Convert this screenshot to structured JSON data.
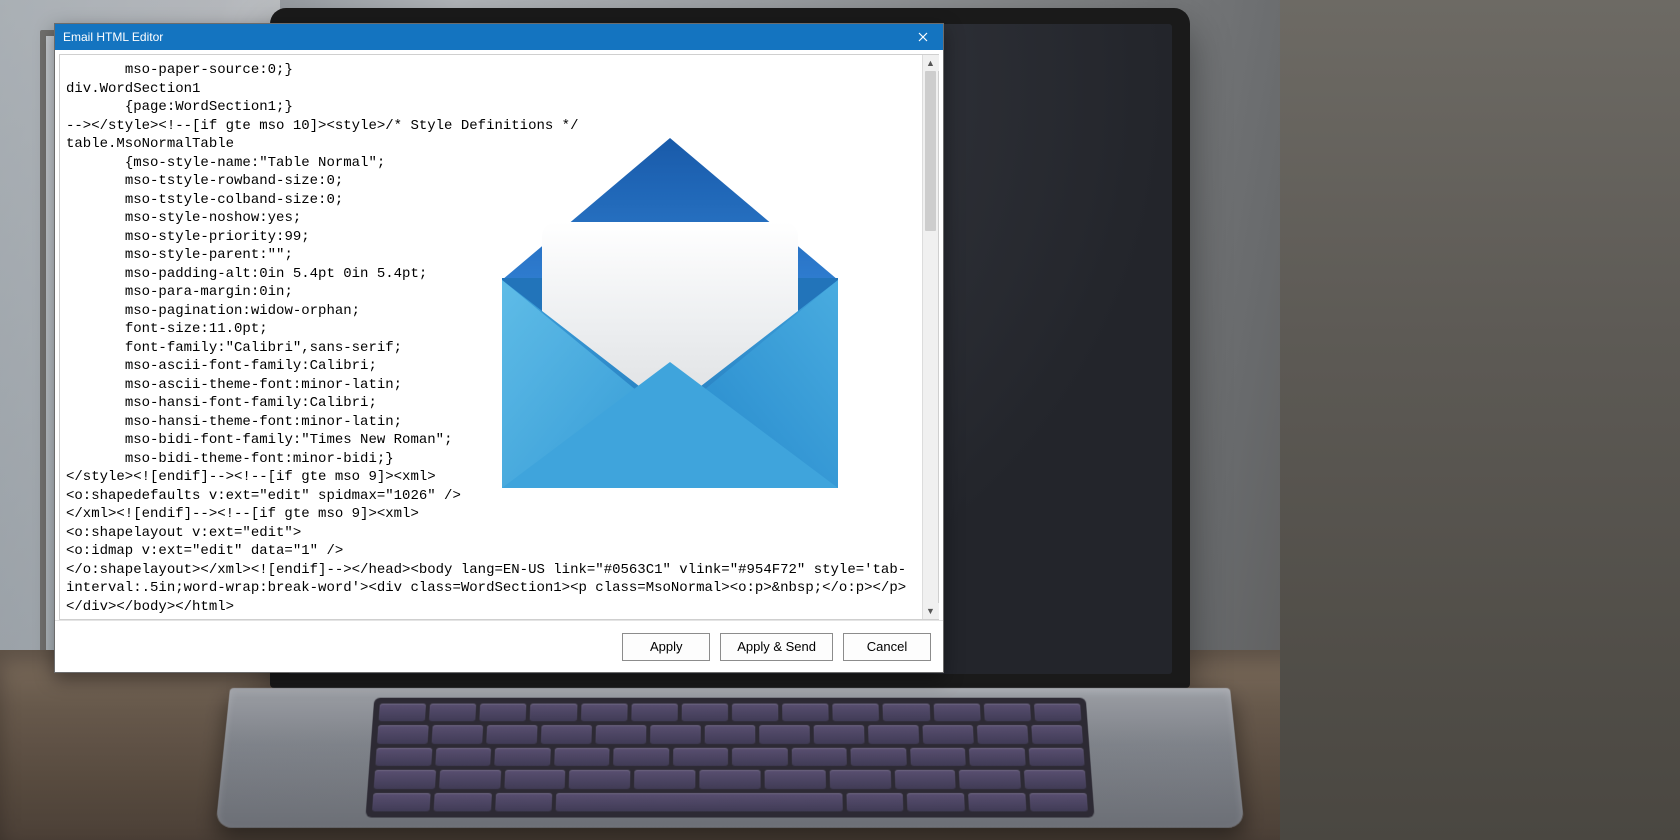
{
  "window": {
    "title": "Email HTML Editor"
  },
  "editor": {
    "content": "       mso-paper-source:0;}\ndiv.WordSection1\n       {page:WordSection1;}\n--></style><!--[if gte mso 10]><style>/* Style Definitions */\ntable.MsoNormalTable\n       {mso-style-name:\"Table Normal\";\n       mso-tstyle-rowband-size:0;\n       mso-tstyle-colband-size:0;\n       mso-style-noshow:yes;\n       mso-style-priority:99;\n       mso-style-parent:\"\";\n       mso-padding-alt:0in 5.4pt 0in 5.4pt;\n       mso-para-margin:0in;\n       mso-pagination:widow-orphan;\n       font-size:11.0pt;\n       font-family:\"Calibri\",sans-serif;\n       mso-ascii-font-family:Calibri;\n       mso-ascii-theme-font:minor-latin;\n       mso-hansi-font-family:Calibri;\n       mso-hansi-theme-font:minor-latin;\n       mso-bidi-font-family:\"Times New Roman\";\n       mso-bidi-theme-font:minor-bidi;}\n</style><![endif]--><!--[if gte mso 9]><xml>\n<o:shapedefaults v:ext=\"edit\" spidmax=\"1026\" />\n</xml><![endif]--><!--[if gte mso 9]><xml>\n<o:shapelayout v:ext=\"edit\">\n<o:idmap v:ext=\"edit\" data=\"1\" />\n</o:shapelayout></xml><![endif]--></head><body lang=EN-US link=\"#0563C1\" vlink=\"#954F72\" style='tab-interval:.5in;word-wrap:break-word'><div class=WordSection1><p class=MsoNormal><o:p>&nbsp;</o:p></p></div></body></html>"
  },
  "buttons": {
    "apply": "Apply",
    "apply_send": "Apply & Send",
    "cancel": "Cancel"
  },
  "icon": {
    "name": "mail-envelope-icon",
    "colors": {
      "back_top": "#0a5cbf",
      "back_bot": "#1d7fe6",
      "front_light": "#37b4f3",
      "front_dark": "#0f8ae0",
      "paper": "#f0f2f4"
    }
  }
}
